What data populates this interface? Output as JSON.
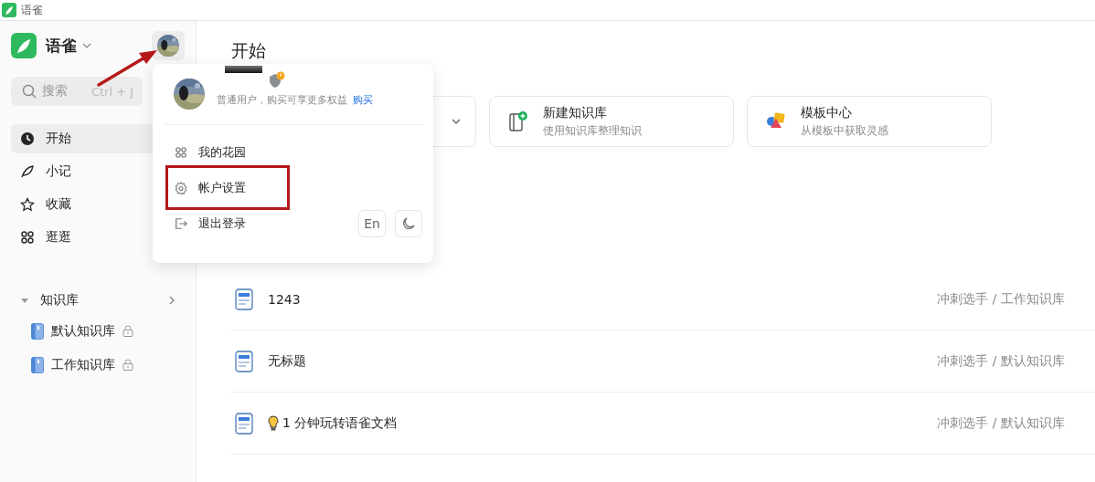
{
  "window": {
    "title": "语雀"
  },
  "sidebar": {
    "brand": "语雀",
    "search": {
      "placeholder": "搜索",
      "shortcut": "Ctrl + J"
    },
    "nav": [
      {
        "label": "开始",
        "kind": "clock",
        "selected": true
      },
      {
        "label": "小记",
        "kind": "feather",
        "selected": false
      },
      {
        "label": "收藏",
        "kind": "star",
        "selected": false
      },
      {
        "label": "逛逛",
        "kind": "grid",
        "selected": false
      }
    ],
    "section": {
      "label": "知识库",
      "expanded": true,
      "children": [
        {
          "label": "默认知识库",
          "locked": true
        },
        {
          "label": "工作知识库",
          "locked": true
        }
      ]
    }
  },
  "main": {
    "title": "开始",
    "quick_actions": [
      {
        "dropdown": true
      },
      {
        "title": "新建知识库",
        "subtitle": "使用知识库整理知识",
        "kind": "book",
        "dropdown": false
      },
      {
        "title": "模板中心",
        "subtitle": "从模板中获取灵感",
        "kind": "shapes",
        "dropdown": false
      }
    ],
    "documents": [
      {
        "title": "1243",
        "path": "冲刺选手 / 工作知识库",
        "tip": false
      },
      {
        "title": "无标题",
        "path": "冲刺选手 / 默认知识库",
        "tip": false
      },
      {
        "title": "1 分钟玩转语雀文档",
        "path": "冲刺选手 / 默认知识库",
        "tip": true
      }
    ]
  },
  "account_menu": {
    "membership": "普通用户，购买可享更多权益",
    "buy_link": "购买",
    "items": [
      {
        "label": "我的花园",
        "kind": "garden",
        "annotated": false
      },
      {
        "label": "帐户设置",
        "kind": "settings",
        "annotated": true
      },
      {
        "label": "退出登录",
        "kind": "logout",
        "annotated": false
      }
    ],
    "language_button": "En"
  }
}
